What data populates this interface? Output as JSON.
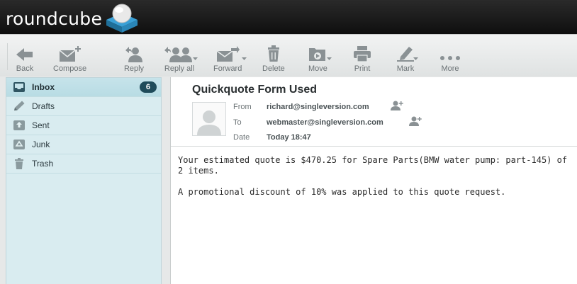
{
  "app": {
    "logo_text": "roundcube"
  },
  "toolbar": {
    "back": "Back",
    "compose": "Compose",
    "reply": "Reply",
    "reply_all": "Reply all",
    "forward": "Forward",
    "delete": "Delete",
    "move": "Move",
    "print": "Print",
    "mark": "Mark",
    "more": "More"
  },
  "folders": [
    {
      "name": "Inbox",
      "icon": "inbox-icon",
      "unread": "6",
      "selected": true
    },
    {
      "name": "Drafts",
      "icon": "pencil-icon"
    },
    {
      "name": "Sent",
      "icon": "sent-icon"
    },
    {
      "name": "Junk",
      "icon": "recycle-icon"
    },
    {
      "name": "Trash",
      "icon": "trash-icon"
    }
  ],
  "message": {
    "subject": "Quickquote Form Used",
    "from_label": "From",
    "from": "richard@singleversion.com",
    "to_label": "To",
    "to": "webmaster@singleversion.com",
    "date_label": "Date",
    "date": "Today 18:47",
    "body": [
      "Your estimated quote is $470.25 for Spare Parts(BMW water pump: part-145) of 2 items.",
      "A promotional discount of 10% was applied to this quote request."
    ]
  },
  "colors": {
    "header_bg": "#1a1a1a",
    "folder_bg": "#d9ecf0",
    "folder_selected_bg": "#bcdde5",
    "badge_bg": "#1f4b5a",
    "icon_gray": "#8a9194"
  }
}
